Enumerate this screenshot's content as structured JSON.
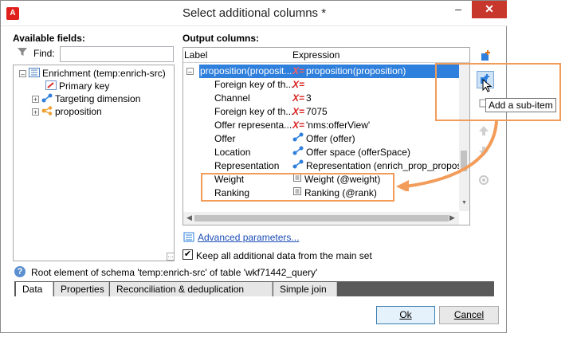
{
  "window": {
    "title": "Select additional columns *",
    "app_icon": "A",
    "minimize": "–",
    "close": "✕"
  },
  "left": {
    "heading": "Available fields:",
    "find_label": "Find:",
    "find_value": "",
    "tree": [
      {
        "label": "Enrichment (temp:enrich-src)",
        "expander": "–",
        "icon": "list-icon"
      },
      {
        "label": "Primary key",
        "expander": "",
        "icon": "key-icon"
      },
      {
        "label": "Targeting dimension",
        "expander": "+",
        "icon": "link-icon"
      },
      {
        "label": "proposition",
        "expander": "+",
        "icon": "share-icon"
      }
    ],
    "ellipsis": "…"
  },
  "output": {
    "heading": "Output columns:",
    "col_label": "Label",
    "col_expression": "Expression",
    "rows": [
      {
        "label": "proposition(proposit...",
        "expr": "proposition(proposition)",
        "x": "X=",
        "selected": true
      },
      {
        "label": "Foreign key of th...",
        "expr": "",
        "x": "X="
      },
      {
        "label": "Channel",
        "expr": "3",
        "x": "X="
      },
      {
        "label": "Foreign key of th...",
        "expr": "7075",
        "x": "X="
      },
      {
        "label": "Offer representa...",
        "expr": "'nms:offerView'",
        "x": "X="
      },
      {
        "label": "Offer",
        "expr": "Offer (offer)",
        "x": ""
      },
      {
        "label": "Location",
        "expr": "Offer space (offerSpace)",
        "x": ""
      },
      {
        "label": "Representation",
        "expr": "Representation (enrich_prop_propos",
        "x": ""
      },
      {
        "label": "Weight",
        "expr": "Weight (@weight)",
        "x": ""
      },
      {
        "label": "Ranking",
        "expr": "Ranking (@rank)",
        "x": ""
      }
    ],
    "tooltip": "Add a sub-item"
  },
  "advanced_link": "Advanced parameters...",
  "keep_checkbox": {
    "label": "Keep all additional data from the main set",
    "checked": true
  },
  "info_text": "Root element of schema 'temp:enrich-src' of table 'wkf71442_query'",
  "tabs": [
    "Data",
    "Properties",
    "Reconciliation & deduplication",
    "Simple join"
  ],
  "buttons": {
    "ok": "Ok",
    "cancel": "Cancel"
  },
  "colors": {
    "accent": "#2f7fdc",
    "highlight": "#f39c5a",
    "close": "#c8372c"
  }
}
